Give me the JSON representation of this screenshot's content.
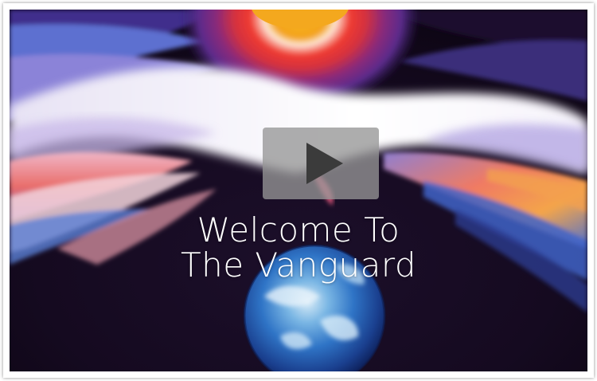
{
  "video": {
    "title_line1": "Welcome To",
    "title_line2": "The Vanguard"
  },
  "icons": {
    "play": "play-icon"
  },
  "colors": {
    "play_button_bg": "#969696",
    "play_triangle": "#3b3b3b",
    "title_text": "#ffffff",
    "space_background": "#12091c"
  }
}
